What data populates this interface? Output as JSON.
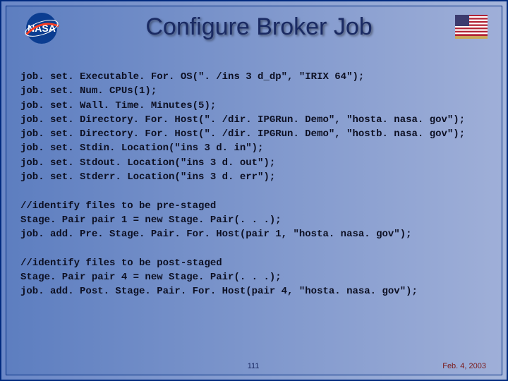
{
  "title": "Configure Broker Job",
  "code_lines": [
    "job. set. Executable. For. OS(\". /ins 3 d_dp\", \"IRIX 64\");",
    "job. set. Num. CPUs(1);",
    "job. set. Wall. Time. Minutes(5);",
    "job. set. Directory. For. Host(\". /dir. IPGRun. Demo\", \"hosta. nasa. gov\");",
    "job. set. Directory. For. Host(\". /dir. IPGRun. Demo\", \"hostb. nasa. gov\");",
    "job. set. Stdin. Location(\"ins 3 d. in\");",
    "job. set. Stdout. Location(\"ins 3 d. out\");",
    "job. set. Stderr. Location(\"ins 3 d. err\");",
    "",
    "//identify files to be pre-staged",
    "Stage. Pair pair 1 = new Stage. Pair(. . .);",
    "job. add. Pre. Stage. Pair. For. Host(pair 1, \"hosta. nasa. gov\");",
    "",
    "//identify files to be post-staged",
    "Stage. Pair pair 4 = new Stage. Pair(. . .);",
    "job. add. Post. Stage. Pair. For. Host(pair 4, \"hosta. nasa. gov\");"
  ],
  "page_number": "111",
  "date": "Feb. 4, 2003",
  "logos": {
    "nasa": "NASA",
    "flag": "US Flag"
  }
}
